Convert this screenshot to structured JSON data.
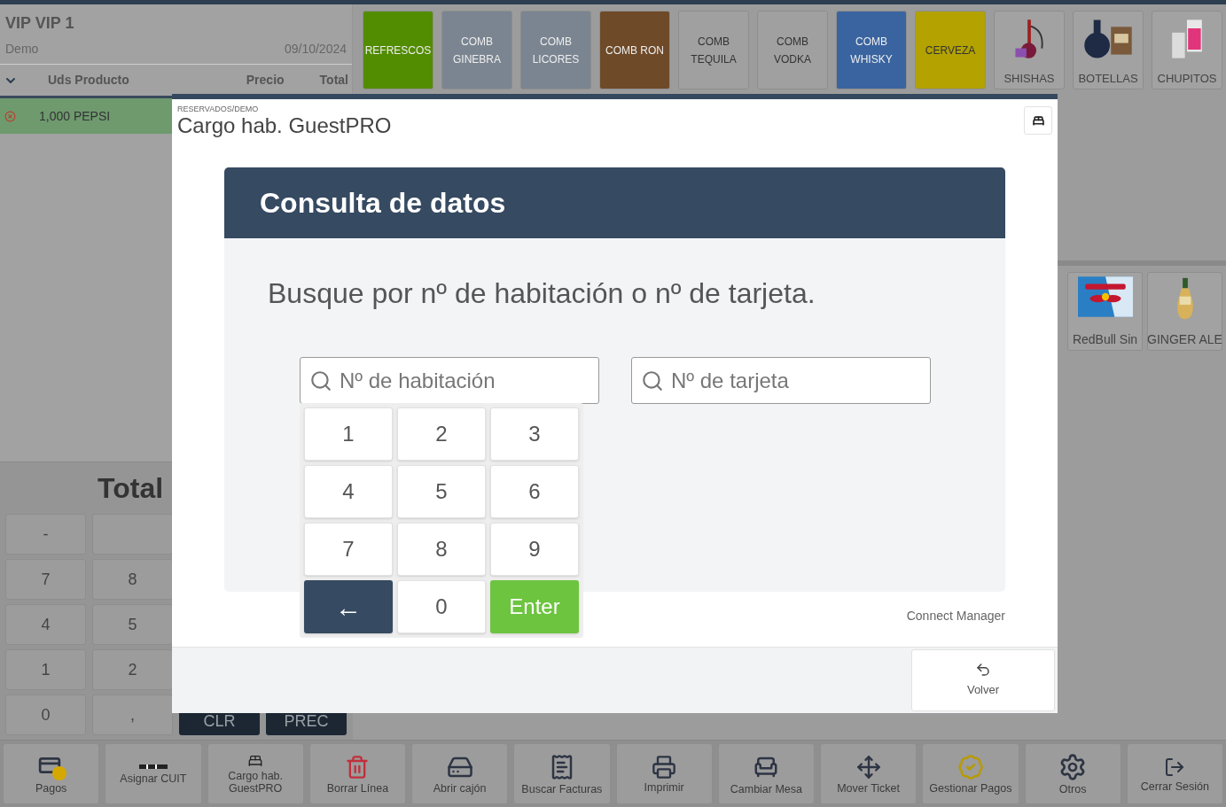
{
  "order": {
    "title": "VIP VIP 1",
    "user": "Demo",
    "date": "09/10/2024",
    "columns": [
      "Uds Producto",
      "Precio",
      "Total"
    ],
    "lines": [
      {
        "units_product": "1,000 PEPSI",
        "selected": true
      }
    ],
    "total_label": "Total",
    "keypad": [
      [
        {
          "label": "-"
        },
        {
          "kind": "blank"
        }
      ],
      [
        {
          "label": "7"
        },
        {
          "label": "8"
        }
      ],
      [
        {
          "label": "4"
        },
        {
          "label": "5"
        }
      ],
      [
        {
          "label": "1"
        },
        {
          "label": "2"
        }
      ],
      [
        {
          "label": "0"
        },
        {
          "label": ","
        },
        {
          "label": "CLR",
          "kind": "dark"
        },
        {
          "label": "PREC",
          "kind": "dark"
        }
      ]
    ]
  },
  "categories": [
    {
      "label": "REFRESCOS",
      "kind": "color",
      "color": "#528c00"
    },
    {
      "label": "COMB GINEBRA",
      "kind": "color",
      "color": "#7b8591"
    },
    {
      "label": "COMB LICORES",
      "kind": "color",
      "color": "#7b8591"
    },
    {
      "label": "COMB RON",
      "kind": "color",
      "color": "#6e4a28"
    },
    {
      "label": "COMB TEQUILA",
      "kind": "color",
      "color": "#a0a0a0"
    },
    {
      "label": "COMB VODKA",
      "kind": "color",
      "color": "#a0a0a0"
    },
    {
      "label": "COMB WHISKY",
      "kind": "color",
      "color": "#3a64a0"
    },
    {
      "label": "CERVEZA",
      "kind": "color",
      "color": "#b3a200"
    },
    {
      "label": "SHISHAS",
      "kind": "picture"
    },
    {
      "label": "BOTELLAS",
      "kind": "picture"
    },
    {
      "label": "CHUPITOS",
      "kind": "picture"
    }
  ],
  "products": [
    {
      "label": "RedBull Sin",
      "kind": "picture"
    },
    {
      "label": "GINGER ALE",
      "kind": "picture"
    }
  ],
  "toolbar": [
    {
      "label": "Pagos"
    },
    {
      "label": "Asignar CUIT"
    },
    {
      "label": "Cargo hab. GuestPRO"
    },
    {
      "label": "Borrar Línea"
    },
    {
      "label": "Abrir cajón"
    },
    {
      "label": "Buscar Facturas"
    },
    {
      "label": "Imprimir"
    },
    {
      "label": "Cambiar Mesa"
    },
    {
      "label": "Mover Ticket"
    },
    {
      "label": "Gestionar Pagos"
    },
    {
      "label": "Otros"
    },
    {
      "label": "Cerrar Sesión"
    }
  ],
  "dialog": {
    "breadcrumb": "RESERVADOS/DEMO",
    "title": "Cargo hab. GuestPRO",
    "panel_title": "Consulta de datos",
    "instruction": "Busque por nº de habitación o nº de tarjeta.",
    "room_field": {
      "placeholder": "Nº de habitación"
    },
    "card_field": {
      "placeholder": "Nº de tarjeta"
    },
    "numpad": [
      {
        "label": "1"
      },
      {
        "label": "2"
      },
      {
        "label": "3"
      },
      {
        "label": "4"
      },
      {
        "label": "5"
      },
      {
        "label": "6"
      },
      {
        "label": "7"
      },
      {
        "label": "8"
      },
      {
        "label": "9"
      },
      {
        "label": "←",
        "kind": "back"
      },
      {
        "label": "0"
      },
      {
        "label": "Enter",
        "kind": "enter"
      }
    ],
    "footer_link": "Connect Manager",
    "back_button": "Volver"
  }
}
